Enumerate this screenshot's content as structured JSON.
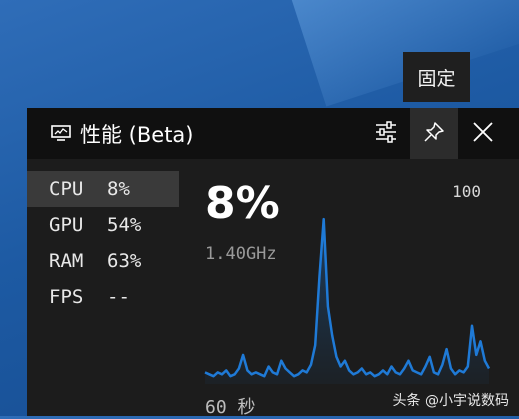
{
  "tooltip": {
    "text": "固定"
  },
  "widget": {
    "title": "性能 (Beta)",
    "icons": {
      "app": "monitor-icon",
      "settings": "sliders-icon",
      "pin": "pin-icon",
      "close": "close-icon"
    },
    "metrics": [
      {
        "label": "CPU",
        "value": "8%",
        "selected": true
      },
      {
        "label": "GPU",
        "value": "54%",
        "selected": false
      },
      {
        "label": "RAM",
        "value": "63%",
        "selected": false
      },
      {
        "label": "FPS",
        "value": "--",
        "selected": false
      }
    ],
    "detail": {
      "current_value": "8%",
      "frequency": "1.40GHz",
      "max_label": "100",
      "time_label": "60 秒"
    },
    "graph_color": "#1f7ad6",
    "cpu_history": [
      6,
      5,
      4,
      6,
      5,
      7,
      4,
      5,
      8,
      15,
      7,
      5,
      6,
      5,
      4,
      9,
      6,
      5,
      12,
      8,
      6,
      4,
      5,
      7,
      6,
      10,
      20,
      55,
      85,
      40,
      25,
      14,
      9,
      12,
      7,
      5,
      6,
      8,
      5,
      6,
      4,
      5,
      7,
      5,
      9,
      6,
      5,
      8,
      12,
      7,
      6,
      5,
      9,
      14,
      6,
      5,
      10,
      18,
      8,
      5,
      7,
      6,
      9,
      30,
      15,
      22,
      12,
      8
    ]
  },
  "watermark": {
    "text": "头条 @小宇说数码"
  }
}
